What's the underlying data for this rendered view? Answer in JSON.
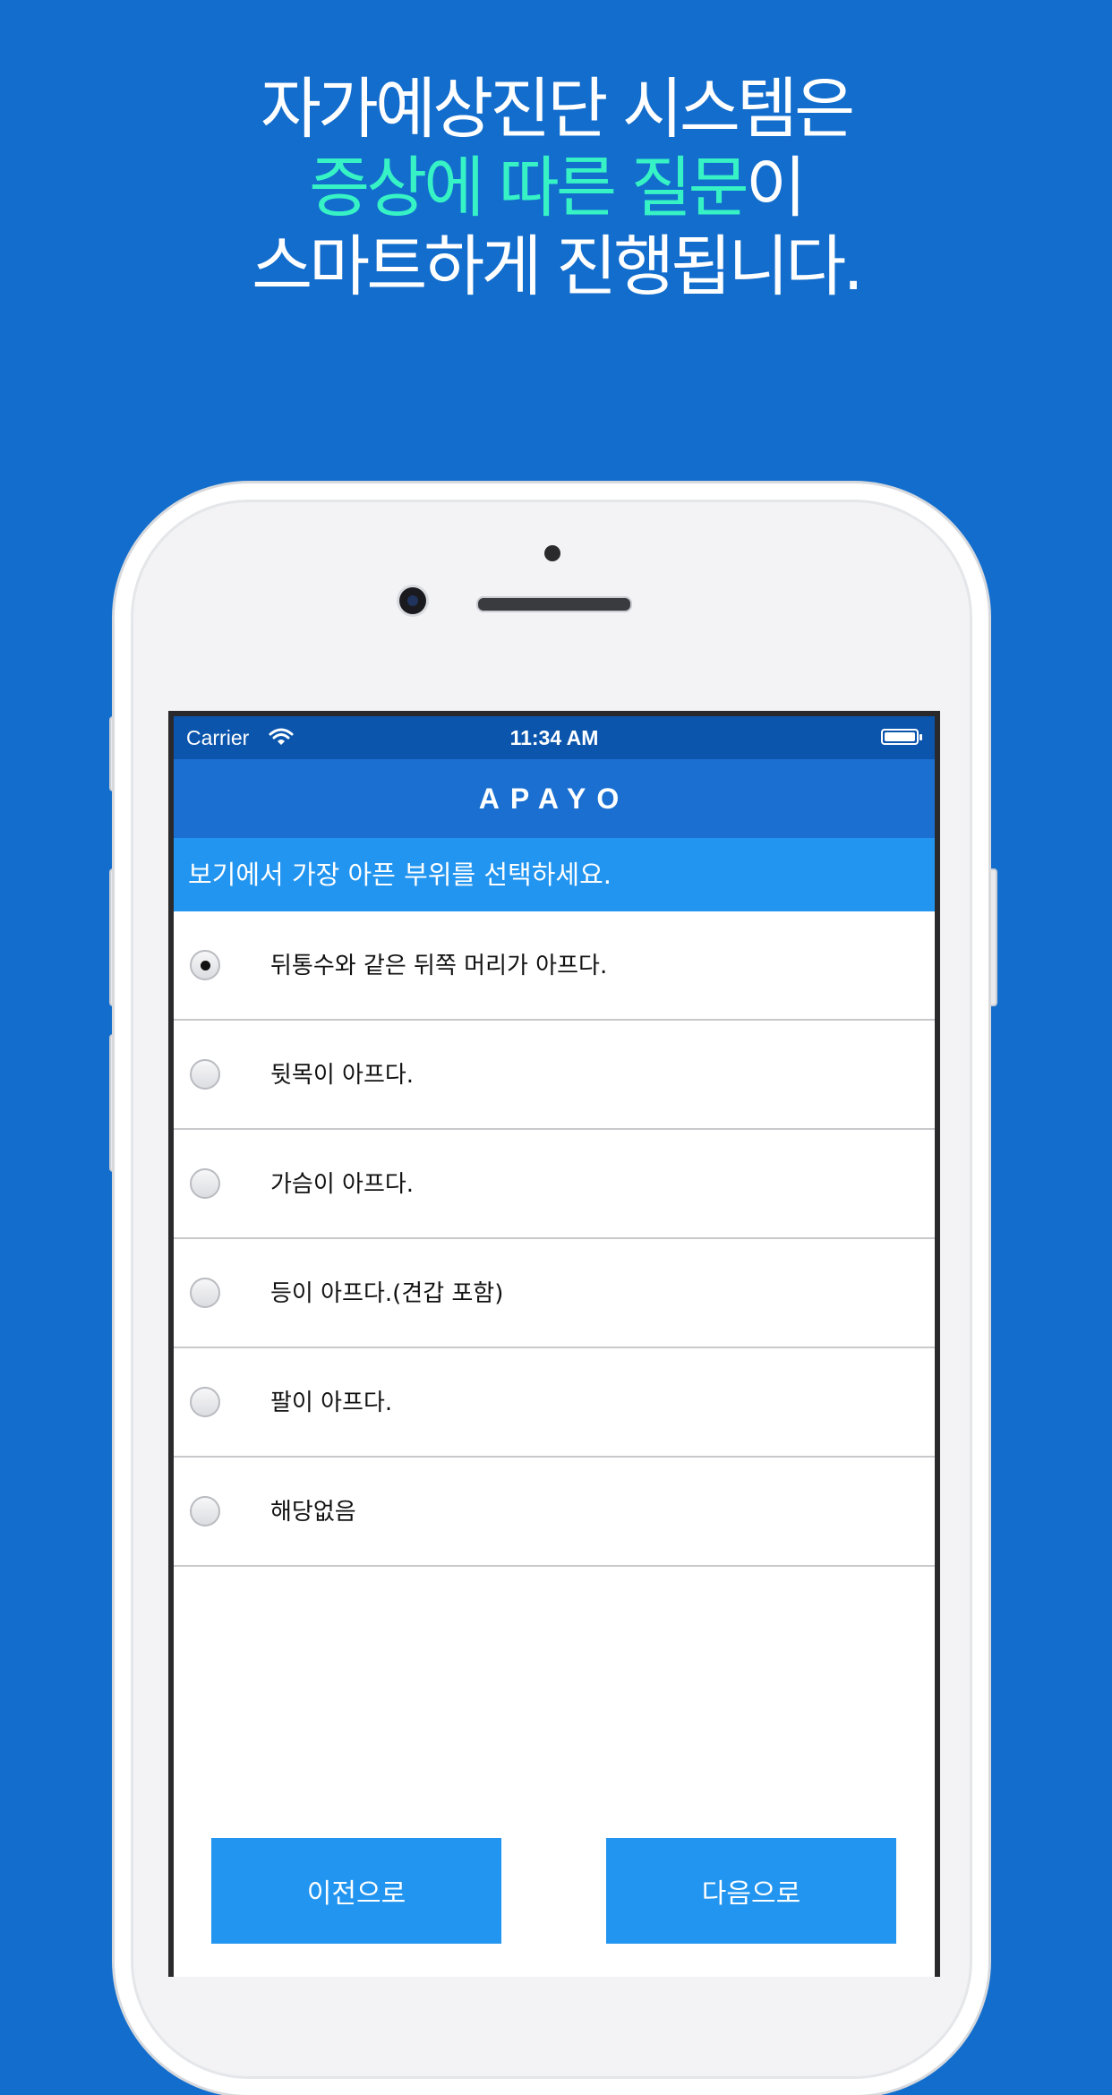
{
  "headline": {
    "line1": "자가예상진단 시스템은",
    "line2_accent": "증상에 따른 질문",
    "line2_rest": "이",
    "line3": "스마트하게 진행됩니다."
  },
  "status_bar": {
    "carrier": "Carrier",
    "time": "11:34 AM"
  },
  "app": {
    "title": "APAYO",
    "instruction": "보기에서 가장 아픈 부위를 선택하세요."
  },
  "options": [
    {
      "label": "뒤통수와 같은 뒤쪽 머리가 아프다.",
      "selected": true
    },
    {
      "label": "뒷목이 아프다.",
      "selected": false
    },
    {
      "label": "가슴이 아프다.",
      "selected": false
    },
    {
      "label": "등이 아프다.(견갑 포함)",
      "selected": false
    },
    {
      "label": "팔이 아프다.",
      "selected": false
    },
    {
      "label": "해당없음",
      "selected": false
    }
  ],
  "buttons": {
    "prev": "이전으로",
    "next": "다음으로"
  },
  "colors": {
    "background": "#126dcd",
    "accent_text": "#36f2c5",
    "nav_bar": "#1a6fd0",
    "button": "#2295f0"
  }
}
